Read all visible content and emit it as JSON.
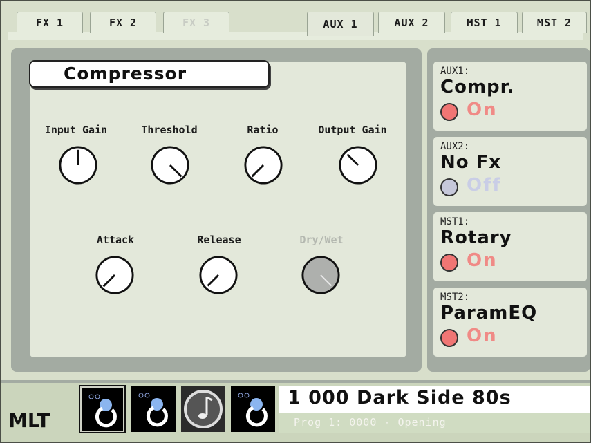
{
  "tabs": [
    {
      "label": "FX 1",
      "enabled": true
    },
    {
      "label": "FX 2",
      "enabled": true
    },
    {
      "label": "FX 3",
      "enabled": false
    },
    {
      "label": "AUX 1",
      "enabled": true,
      "active": true
    },
    {
      "label": "AUX 2",
      "enabled": true
    },
    {
      "label": "MST 1",
      "enabled": true
    },
    {
      "label": "MST 2",
      "enabled": true
    }
  ],
  "effect": {
    "title": "Compressor",
    "knobs": {
      "input_gain": {
        "label": "Input Gain"
      },
      "threshold": {
        "label": "Threshold"
      },
      "ratio": {
        "label": "Ratio"
      },
      "output_gain": {
        "label": "Output Gain"
      },
      "attack": {
        "label": "Attack"
      },
      "release": {
        "label": "Release"
      },
      "dry_wet": {
        "label": "Dry/Wet",
        "enabled": false
      }
    }
  },
  "slots": [
    {
      "label": "AUX1:",
      "name": "Compr.",
      "state": "On",
      "on": true
    },
    {
      "label": "AUX2:",
      "name": "No Fx",
      "state": "Off",
      "on": false
    },
    {
      "label": "MST1:",
      "name": "Rotary",
      "state": "On",
      "on": true
    },
    {
      "label": "MST2:",
      "name": "ParamEQ",
      "state": "On",
      "on": true
    }
  ],
  "colors": {
    "led_on": "#f07674",
    "led_off": "#c6c8da",
    "state_on": "#f08a86",
    "state_off": "#c9cde6"
  },
  "bottom": {
    "logo": "MLT",
    "patch_name": "1 000 Dark Side 80s",
    "patch_sub": "Prog 1: 0000 - Opening",
    "icons": [
      "output-port-icon",
      "output-port-icon",
      "note-icon",
      "output-port-icon"
    ]
  }
}
